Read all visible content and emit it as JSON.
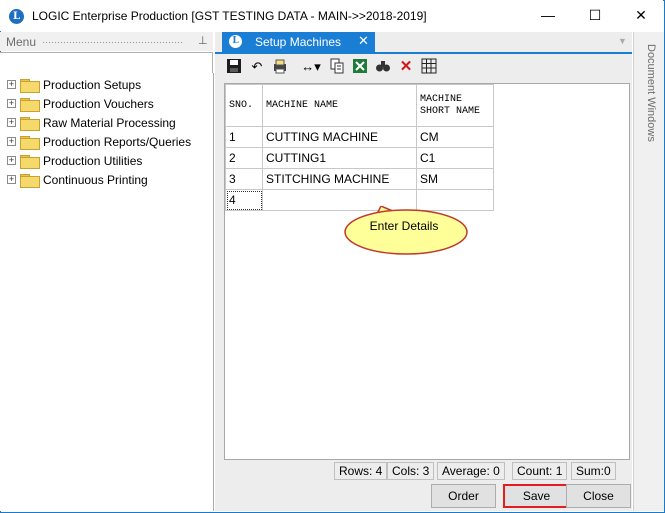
{
  "window": {
    "logo_letter": "L",
    "title": "LOGIC Enterprise Production  [GST TESTING DATA - MAIN->>2018-2019]",
    "controls": {
      "minimize": "—",
      "maximize": "☐",
      "close": "✕"
    }
  },
  "menu": {
    "header": "Menu",
    "pin": "⊥",
    "items": [
      {
        "label": "Production Setups"
      },
      {
        "label": "Production Vouchers"
      },
      {
        "label": "Raw Material Processing"
      },
      {
        "label": "Production Reports/Queries"
      },
      {
        "label": "Production Utilities"
      },
      {
        "label": "Continuous Printing"
      }
    ],
    "expander_symbol": "+"
  },
  "tab": {
    "logo_letter": "L",
    "label": "Setup Machines",
    "close": "✕",
    "dropdown": "▼"
  },
  "toolbar": {
    "icons": [
      "save-icon",
      "undo-icon",
      "print-icon",
      "column-width-icon",
      "copy-icon",
      "excel-icon",
      "find-icon",
      "delete-icon",
      "grid-icon"
    ],
    "glyphs": {
      "undo": "↶",
      "width": "↔▾",
      "find": "🔍",
      "delete": "✕"
    }
  },
  "grid": {
    "headers": [
      "SNO.",
      "MACHINE NAME",
      "MACHINE SHORT NAME"
    ],
    "rows": [
      [
        "1",
        "CUTTING MACHINE",
        "CM"
      ],
      [
        "2",
        "CUTTING1",
        "C1"
      ],
      [
        "3",
        "STITCHING MACHINE",
        "SM"
      ],
      [
        "4",
        "",
        ""
      ]
    ]
  },
  "callout": {
    "text": "Enter Details"
  },
  "status": {
    "rows": "Rows: 4",
    "cols": "Cols: 3",
    "average": "Average: 0",
    "count": "Count: 1",
    "sum": "Sum:0"
  },
  "buttons": {
    "order": "Order",
    "save": "Save",
    "close": "Close"
  },
  "right_rail": {
    "label": "Document Windows"
  },
  "colors": {
    "accent": "#1a7fd4",
    "highlight": "#e02020",
    "callout_fill": "#ffff99"
  }
}
